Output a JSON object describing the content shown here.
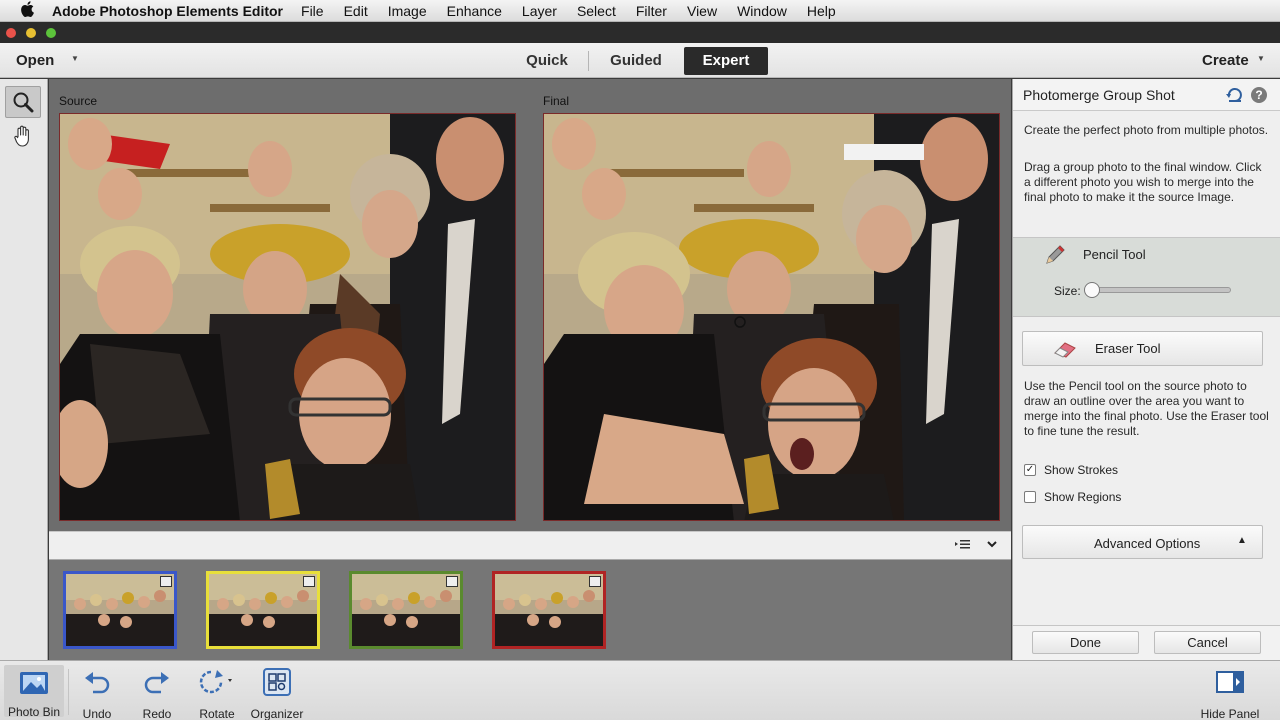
{
  "menubar": {
    "app_name": "Adobe Photoshop Elements Editor",
    "items": [
      "File",
      "Edit",
      "Image",
      "Enhance",
      "Layer",
      "Select",
      "Filter",
      "View",
      "Window",
      "Help"
    ]
  },
  "modebar": {
    "open_label": "Open",
    "tabs": [
      "Quick",
      "Guided",
      "Expert"
    ],
    "active_tab": "Expert",
    "create_label": "Create"
  },
  "toolbox": {
    "tools": [
      "zoom-tool",
      "hand-tool"
    ],
    "active_tool": "zoom-tool"
  },
  "canvas": {
    "source_label": "Source",
    "final_label": "Final"
  },
  "photo_bin": {
    "thumbnails": [
      {
        "border_color": "#3a57c9"
      },
      {
        "border_color": "#e8df3a"
      },
      {
        "border_color": "#5a8a2e"
      },
      {
        "border_color": "#b02424"
      }
    ]
  },
  "panel": {
    "title": "Photomerge Group Shot",
    "intro_1": "Create the perfect photo from multiple photos.",
    "intro_2": "Drag a group photo to the final window. Click a different photo you wish to merge into the final photo to make it the source Image.",
    "pencil_label": "Pencil Tool",
    "size_label": "Size:",
    "size_value": 0,
    "eraser_label": "Eraser Tool",
    "help_text": "Use the Pencil tool on the source photo to draw an outline over the area you want to merge into the final photo. Use the Eraser tool to fine tune the result.",
    "show_strokes_label": "Show Strokes",
    "show_strokes_checked": true,
    "show_regions_label": "Show Regions",
    "show_regions_checked": false,
    "advanced_label": "Advanced Options",
    "done_label": "Done",
    "cancel_label": "Cancel"
  },
  "taskbar": {
    "photo_bin": "Photo Bin",
    "undo": "Undo",
    "redo": "Redo",
    "rotate": "Rotate",
    "organizer": "Organizer",
    "hide_panel": "Hide Panel"
  },
  "colors": {
    "active_tab_bg": "#2a2a2a",
    "photo_border": "#7a2a2a",
    "canvas_bg": "#6d6d6d"
  }
}
